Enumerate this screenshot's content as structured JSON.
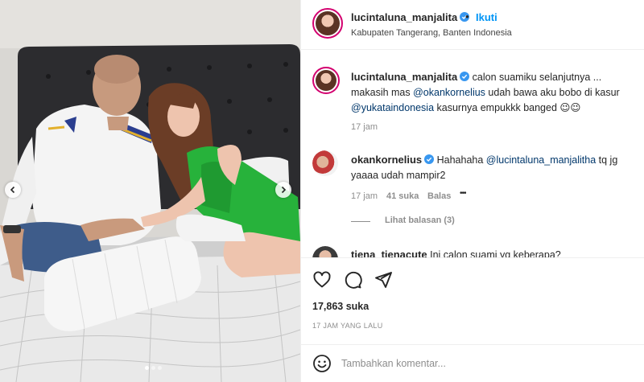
{
  "header": {
    "username": "lucintaluna_manjalita",
    "separator": "•",
    "follow_label": "Ikuti",
    "location": "Kabupaten Tangerang, Banten Indonesia"
  },
  "caption": {
    "username": "lucintaluna_manjalita",
    "text_1": " calon suamiku selanjutnya ... makasih mas ",
    "mention_1": "@okankornelius",
    "text_2": " udah bawa aku bobo di kasur ",
    "mention_2": "@yukataindonesia",
    "text_3": " kasurnya empukkk banged ",
    "emojis": "😉😉",
    "age": "17 jam"
  },
  "comments": [
    {
      "username": "okankornelius",
      "text_1": " Hahahaha ",
      "mention": "@lucintaluna_manjalitha",
      "text_2": " tq jg yaaaa udah mampir2",
      "age": "17 jam",
      "likes": "41 suka",
      "reply_label": "Balas",
      "more_label": "•••",
      "view_replies": "Lihat balasan (3)"
    },
    {
      "username": "tiena_tienacute",
      "text": " Ini calon suami yg keberapa?"
    }
  ],
  "actions": {
    "like_icon": "heart-icon",
    "comment_icon": "comment-icon",
    "share_icon": "share-icon",
    "likes_count": "17,863 suka",
    "timestamp": "17 JAM YANG LALU"
  },
  "add_comment": {
    "placeholder": "Tambahkan komentar..."
  },
  "colors": {
    "accent": "#0095f6",
    "mention": "#00376b",
    "verified": "#3897f0",
    "story_ring": "#d3006f",
    "muted": "#8e8e8e"
  }
}
